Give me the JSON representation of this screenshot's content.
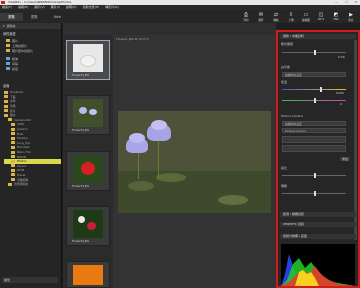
{
  "window": {
    "title": "ViewNX-i - C:\\Users\\NIKON\\Pictures\\Photos",
    "min": "—",
    "max": "☐",
    "close": "✕"
  },
  "menu": [
    "檔案(F)",
    "編輯(E)",
    "顯示(V)",
    "圖片(I)",
    "說明(H)",
    "協助支援(H)",
    "轉影片(R)"
  ],
  "tabs": [
    "瀏覽",
    "瀏覽",
    "Web"
  ],
  "toolbar_right": [
    {
      "icon": "print-icon",
      "label": "列印"
    },
    {
      "icon": "email-icon",
      "label": "郵件"
    },
    {
      "icon": "convert-icon",
      "label": "轉換"
    },
    {
      "icon": "upload-icon",
      "label": "上傳"
    },
    {
      "icon": "folder-icon",
      "label": "編輯器"
    },
    {
      "icon": "nx-studio-icon",
      "label": "NX S"
    },
    {
      "icon": "viewnx-icon",
      "label": "VNX"
    },
    {
      "icon": "movie-icon",
      "label": "影片"
    }
  ],
  "left": {
    "header": "資料夾",
    "sections": [
      {
        "title": "我的最愛",
        "items": [
          "圖片",
          "上傳的照片",
          "圖片庫中的照片"
        ]
      },
      {
        "title": "",
        "items": [
          "相簿",
          "草稿",
          "捷徑"
        ]
      }
    ],
    "tree_title": "桌面",
    "tree": [
      "OneDrive",
      "下載",
      "文件",
      "音樂",
      "影片",
      "圖片",
      "Camera Roll",
      "2020",
      "Autumn",
      "Blue",
      "Flowers",
      "Long_Trip",
      "Mountain",
      "Nikon Trip",
      "NIKON",
      "Photos",
      "Saved",
      "DCIM",
      "Travel",
      "手機相簿",
      "新增資料夾"
    ],
    "selected": "Photos",
    "bottom": "屬性"
  },
  "thumbs": {
    "top": "1/13",
    "items": [
      {
        "cap": "Flower01.JPG"
      },
      {
        "cap": "Flower02.JPG"
      },
      {
        "cap": "Flower03.JPG"
      },
      {
        "cap": "Flower04.JPG"
      },
      {
        "cap": "Flower05.JPG"
      }
    ]
  },
  "viewer": {
    "info": "Flower1.JPG  ⊕ 13.3 %",
    "page": "1 / 13"
  },
  "right": {
    "header": "調整 / 中繼資料",
    "sec1": "曝光補償",
    "ev_value": "0.00",
    "sec2": "白平衡",
    "wb_value": "拍攝時的設定",
    "temp_label": "色溫",
    "temp_value": "5200",
    "tint_value": "0",
    "picture_control": "Picture Control",
    "pc_value": "拍攝時的設定",
    "pc2": "Picture Control",
    "reset": "重設",
    "contrast": "對比",
    "brightness": "明暗",
    "sec_lens": "鏡頭 / 相機資訊",
    "sec_xmp": "XMP/IPTC 資訊",
    "hist_title": "色階分佈圖 / 亮度"
  }
}
